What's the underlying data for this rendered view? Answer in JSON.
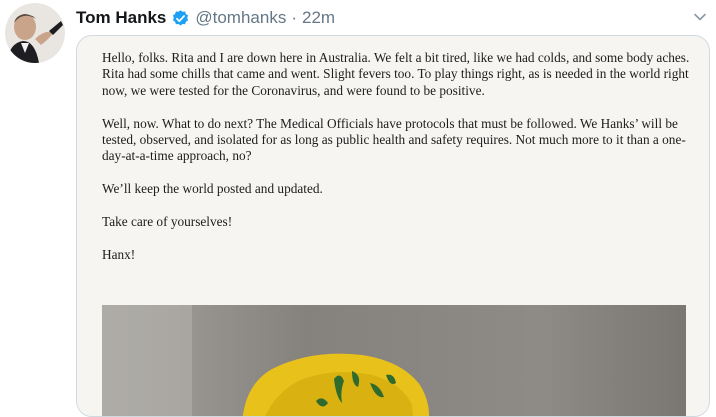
{
  "tweet": {
    "author": {
      "display_name": "Tom Hanks",
      "handle": "@tomhanks",
      "verified": true,
      "avatar_icon": "profile-photo"
    },
    "separator": "·",
    "timestamp": "22m",
    "menu_icon": "chevron-down-icon",
    "media": {
      "letter_paragraphs": [
        "Hello, folks. Rita and I are down here in Australia. We felt a bit tired, like we had colds, and some body aches. Rita had some chills that came and went. Slight fevers too. To play things right, as is needed in the world right now, we were tested for the Coronavirus, and were found to be positive.",
        "Well, now. What to do next? The Medical Officials have protocols that must be followed. We Hanks’ will be tested, observed, and isolated for as long as public health and safety requires.  Not much more to it than a one-day-at-a-time approach, no?",
        "We’ll keep the world posted and updated.",
        "Take care of yourselves!",
        "Hanx!"
      ],
      "photo_colors": {
        "wall": "#8e8b86",
        "glove": "#e8c21a",
        "print": "#2f6b2c"
      }
    },
    "colors": {
      "name": "#14171a",
      "secondary": "#657786",
      "verified_badge": "#1da1f2",
      "card_border": "#cfd9de"
    }
  }
}
